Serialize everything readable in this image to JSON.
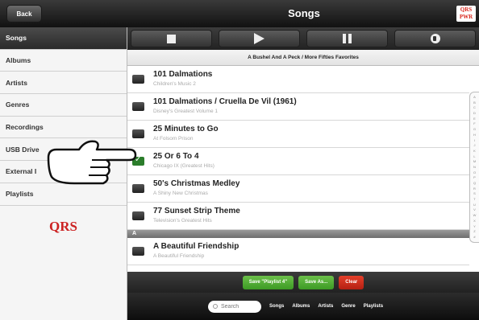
{
  "header": {
    "back_label": "Back",
    "title": "Songs",
    "logo_text": "QRS PWR"
  },
  "sidebar": {
    "items": [
      {
        "label": "Songs",
        "active": true
      },
      {
        "label": "Albums"
      },
      {
        "label": "Artists"
      },
      {
        "label": "Genres"
      },
      {
        "label": "Recordings"
      },
      {
        "label": "USB Drive"
      },
      {
        "label": "External I"
      },
      {
        "label": "Playlists"
      }
    ],
    "logo": "QRS"
  },
  "transport": {
    "icons": [
      "stop-icon",
      "play-icon",
      "pause-icon",
      "volume-icon"
    ]
  },
  "now_playing": "A Bushel And A Peck / More Fifties Favorites",
  "songs": [
    {
      "title": "101 Dalmations",
      "album": "Children's Music 2",
      "checked": false
    },
    {
      "title": "101 Dalmations / Cruella De Vil (1961)",
      "album": "Disney's Greatest Volume 1",
      "checked": false
    },
    {
      "title": "25 Minutes to Go",
      "album": "At Folsom Prison",
      "checked": false
    },
    {
      "title": "25 Or 6 To 4",
      "album": "Chicago IX (Greatest Hits)",
      "checked": true
    },
    {
      "title": "50's Christmas Medley",
      "album": "A Shiny New Christmas",
      "checked": false
    },
    {
      "title": "77 Sunset Strip Theme",
      "album": "Television's Greatest Hits",
      "checked": false
    }
  ],
  "section_header": "A",
  "songs_after_section": [
    {
      "title": "A Beautiful Friendship",
      "album": "A Beautiful Friendship",
      "checked": false
    }
  ],
  "alpha_index": [
    "A",
    "B",
    "C",
    "D",
    "E",
    "F",
    "G",
    "H",
    "I",
    "J",
    "K",
    "L",
    "M",
    "N",
    "O",
    "P",
    "Q",
    "R",
    "S",
    "T",
    "U",
    "V",
    "W",
    "X",
    "Y",
    "Z",
    "#"
  ],
  "actions": {
    "save_playlist": "Save \"Playlist 4\"",
    "save_as": "Save As...",
    "clear": "Clear"
  },
  "tabbar": {
    "search_placeholder": "Search",
    "tabs": [
      "Songs",
      "Albums",
      "Artists",
      "Genre",
      "Playlists"
    ]
  },
  "colors": {
    "accent_green": "#4caf2f",
    "accent_red": "#d0301e",
    "brand_red": "#cc2222"
  }
}
